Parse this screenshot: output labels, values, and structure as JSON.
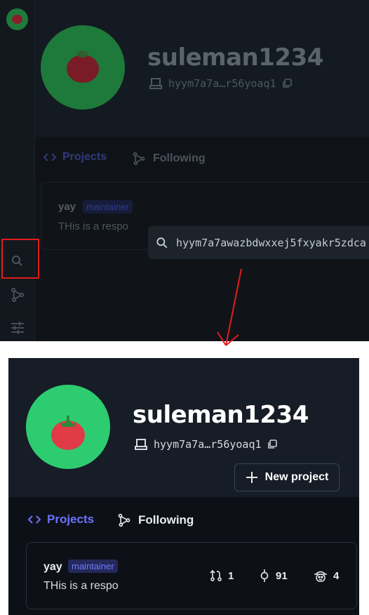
{
  "profile": {
    "username": "suleman1234",
    "address": "hyym7a7a…r56yoaq1",
    "new_project_label": "New project"
  },
  "tabs": [
    {
      "label": "Projects",
      "icon": "code-icon",
      "active": true
    },
    {
      "label": "Following",
      "icon": "share-graph-icon",
      "active": false
    }
  ],
  "repo": {
    "name": "yay",
    "role": "maintainer",
    "description": "THis is a respo",
    "stats": {
      "pull_requests": "1",
      "commits": "91",
      "contributors": "4"
    }
  },
  "sidebar": {
    "icons": [
      "search-icon",
      "share-graph-icon",
      "sliders-icon"
    ]
  },
  "search_popup": {
    "value": "hyym7a7awazbdwxxej5fxyakr5zdca"
  },
  "colors": {
    "accent": "#6c72ff",
    "avatar_bg": "#2ecc71",
    "tomato": "#e03b47",
    "highlight": "#e21b1b",
    "background": "#0d1117"
  }
}
